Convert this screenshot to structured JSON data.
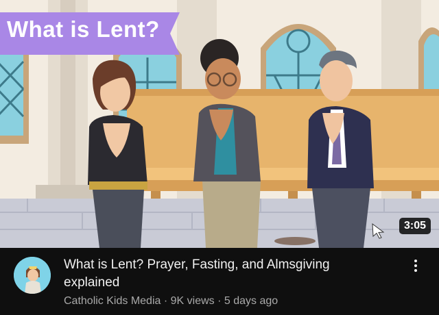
{
  "video": {
    "thumbnail_overlay_title": "What is Lent?",
    "duration": "3:05",
    "title": "What is Lent? Prayer, Fasting, and Almsgiving explained",
    "channel": "Catholic Kids Media",
    "views": "9K views",
    "age": "5 days ago",
    "separator": "·"
  },
  "colors": {
    "banner": "#a987e6",
    "background": "#0f0f0f",
    "title_text": "#f1f1f1",
    "meta_text": "#aaaaaa"
  },
  "icons": {
    "menu": "more-vert-icon",
    "cursor": "cursor-icon"
  }
}
